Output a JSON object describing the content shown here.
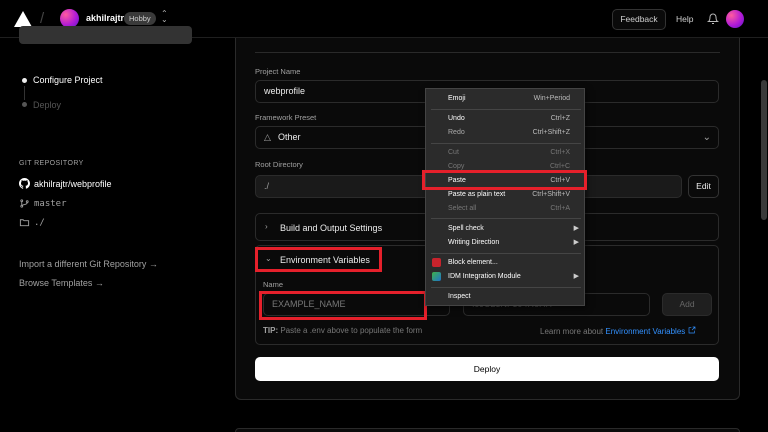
{
  "topbar": {
    "team_name": "akhilrajtr",
    "plan_badge": "Hobby",
    "feedback_label": "Feedback",
    "help_label": "Help"
  },
  "sidebar": {
    "steps": [
      {
        "label": "Configure Project",
        "active": true
      },
      {
        "label": "Deploy",
        "active": false
      }
    ],
    "git_repository_title": "GIT REPOSITORY",
    "repo": "akhilrajtr/webprofile",
    "branch": "master",
    "directory": "./",
    "import_link": "Import a different Git Repository →",
    "browse_link": "Browse Templates →"
  },
  "form": {
    "project_name_label": "Project Name",
    "project_name_value": "webprofile",
    "framework_label": "Framework Preset",
    "framework_value": "Other",
    "root_dir_label": "Root Directory",
    "root_dir_value": "./",
    "edit_label": "Edit",
    "build_settings_label": "Build and Output Settings",
    "env_vars_label": "Environment Variables",
    "env_name_label": "Name",
    "env_name_placeholder": "EXAMPLE_NAME",
    "env_value_placeholder": "I9JU23NF394R6HH",
    "add_label": "Add",
    "tip_prefix": "TIP:",
    "tip_text": "Paste a .env above to populate the form",
    "learn_prefix": "Learn more about",
    "learn_link": "Environment Variables",
    "deploy_label": "Deploy"
  },
  "context_menu": {
    "items": [
      {
        "label": "Emoji",
        "shortcut": "Win+Period"
      },
      {
        "label": "Undo",
        "shortcut": "Ctrl+Z"
      },
      {
        "label": "Redo",
        "shortcut": "Ctrl+Shift+Z"
      },
      {
        "label": "Cut",
        "shortcut": "Ctrl+X"
      },
      {
        "label": "Copy",
        "shortcut": "Ctrl+C"
      },
      {
        "label": "Paste",
        "shortcut": "Ctrl+V"
      },
      {
        "label": "Paste as plain text",
        "shortcut": "Ctrl+Shift+V"
      },
      {
        "label": "Select all",
        "shortcut": "Ctrl+A"
      },
      {
        "label": "Spell check",
        "shortcut": ""
      },
      {
        "label": "Writing Direction",
        "shortcut": ""
      },
      {
        "label": "Block element...",
        "shortcut": ""
      },
      {
        "label": "IDM Integration Module",
        "shortcut": ""
      },
      {
        "label": "Inspect",
        "shortcut": ""
      }
    ]
  },
  "colors": {
    "highlight": "#e5202b",
    "link": "#3291ff",
    "background": "#000000"
  }
}
